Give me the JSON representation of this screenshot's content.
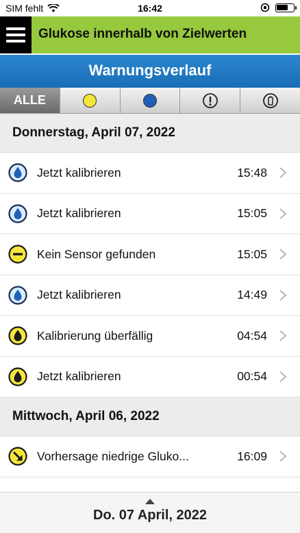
{
  "status_bar": {
    "carrier": "SIM fehlt",
    "time": "16:42",
    "battery_level": 0.7
  },
  "header": {
    "title": "Glukose innerhalb von Zielwerten",
    "color": "#96c93d"
  },
  "title_bar": {
    "title": "Warnungsverlauf",
    "color": "#1f78c4"
  },
  "filter_tabs": [
    {
      "label": "ALLE",
      "icon": null,
      "active": true
    },
    {
      "label": "",
      "icon": "yellow-dot-icon",
      "active": false
    },
    {
      "label": "",
      "icon": "blue-dot-icon",
      "active": false
    },
    {
      "label": "",
      "icon": "exclamation-icon",
      "active": false
    },
    {
      "label": "",
      "icon": "battery-icon",
      "active": false
    }
  ],
  "sections": [
    {
      "date": "Donnerstag, April 07, 2022",
      "items": [
        {
          "label": "Jetzt kalibrieren",
          "time": "15:48",
          "icon": "blue-drop-icon"
        },
        {
          "label": "Jetzt kalibrieren",
          "time": "15:05",
          "icon": "blue-drop-icon"
        },
        {
          "label": "Kein Sensor gefunden",
          "time": "15:05",
          "icon": "yellow-minus-icon"
        },
        {
          "label": "Jetzt kalibrieren",
          "time": "14:49",
          "icon": "blue-drop-icon"
        },
        {
          "label": "Kalibrierung überfällig",
          "time": "04:54",
          "icon": "yellow-drop-icon"
        },
        {
          "label": "Jetzt kalibrieren",
          "time": "00:54",
          "icon": "yellow-drop-icon"
        }
      ]
    },
    {
      "date": "Mittwoch, April 06, 2022",
      "items": [
        {
          "label": "Vorhersage niedrige Gluko...",
          "time": "16:09",
          "icon": "yellow-arrow-down-icon"
        }
      ]
    }
  ],
  "bottom_bar": {
    "date": "Do. 07 April, 2022"
  }
}
